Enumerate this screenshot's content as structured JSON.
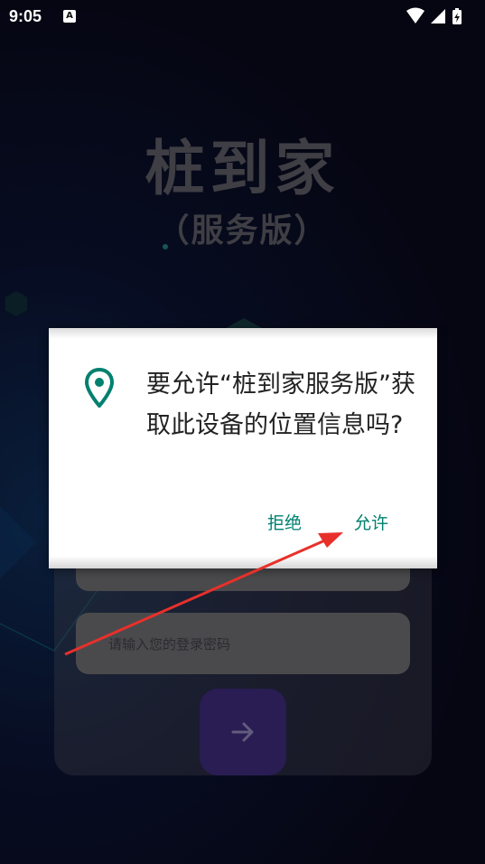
{
  "status_bar": {
    "time": "9:05",
    "notification_badge": "A"
  },
  "app": {
    "title": "桩到家",
    "subtitle": "（服务版）",
    "password_placeholder": "请输入您的登录密码",
    "submit_icon": "arrow-right-icon"
  },
  "dialog": {
    "message": "要允许“桩到家服务版”获取此设备的位置信息吗?",
    "icon": "location-pin-icon",
    "deny_label": "拒绝",
    "allow_label": "允许"
  },
  "colors": {
    "accent": "#00806f",
    "annotation_arrow": "#e8302a",
    "submit_button": "#3b2a78"
  }
}
